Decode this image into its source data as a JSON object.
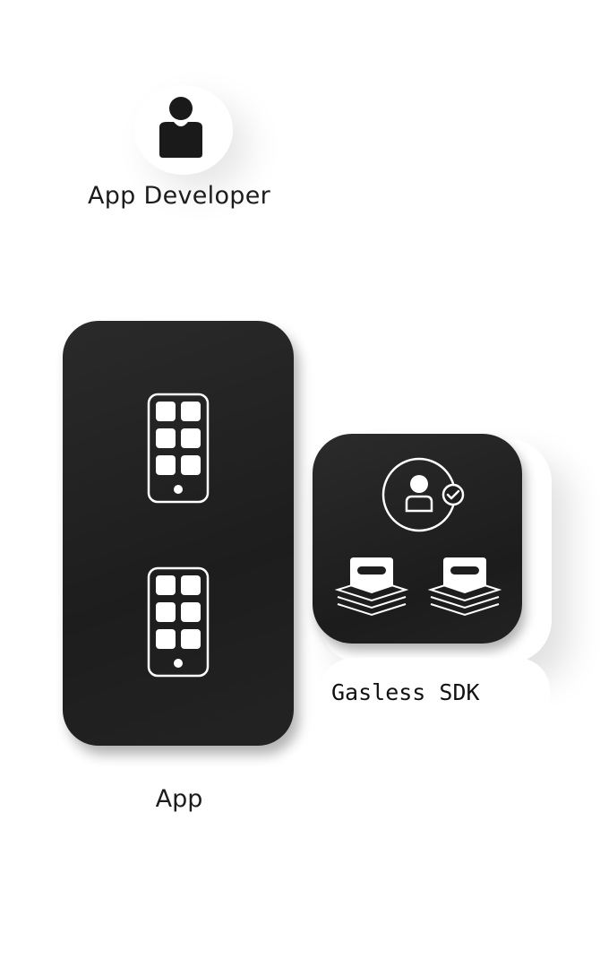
{
  "developer": {
    "label": "App Developer",
    "icon": "user-icon"
  },
  "app": {
    "label": "App",
    "icons": [
      "smartphone-apps-icon",
      "smartphone-apps-icon"
    ],
    "panel_color": "#1e1e1e"
  },
  "sdk": {
    "label": "Gasless SDK",
    "icons": [
      "verified-user-icon",
      "token-stack-icon",
      "token-stack-icon"
    ],
    "panel_color": "#1e1e1e"
  },
  "colors": {
    "background": "#ffffff",
    "panel": "#1e1e1e",
    "icon_stroke": "#ffffff",
    "text": "#1c1c1c"
  }
}
